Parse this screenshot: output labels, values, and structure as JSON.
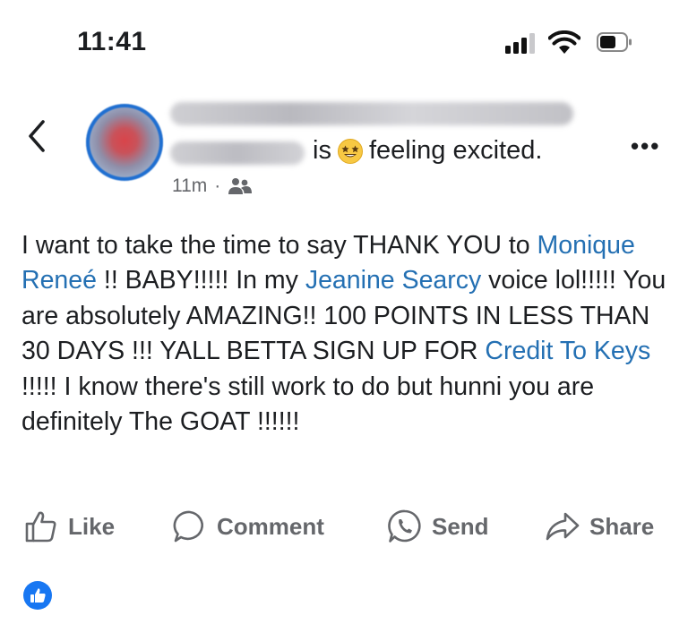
{
  "status_bar": {
    "time": "11:41"
  },
  "post": {
    "author_feeling_prefix": "is",
    "feeling_text": "feeling excited.",
    "timestamp": "11m",
    "separator": "·",
    "audience_icon": "friends-icon",
    "body": {
      "t1": "I want to take the time to say THANK YOU to ",
      "link1": "Monique Reneé",
      "t2": " !!  BABY!!!!!  In my ",
      "link2": "Jeanine Searcy",
      "t3": " voice lol!!!!!  You are absolutely AMAZING!!  100 POINTS IN LESS THAN 30 DAYS !!!  YALL BETTA SIGN UP FOR ",
      "link3": "Credit To Keys",
      "t4": " !!!!!  I know there's still work to do but hunni you are definitely The GOAT !!!!!!"
    }
  },
  "actions": {
    "like": "Like",
    "comment": "Comment",
    "send": "Send",
    "share": "Share"
  },
  "colors": {
    "link": "#2470b3",
    "accent": "#1877f2",
    "muted": "#65676b"
  }
}
